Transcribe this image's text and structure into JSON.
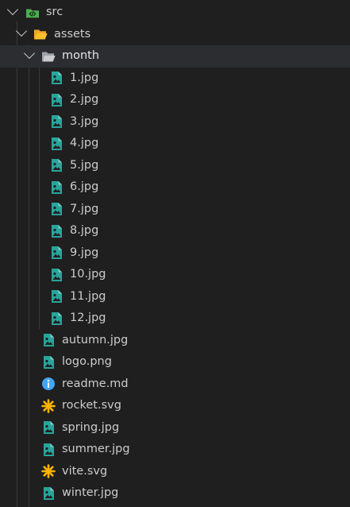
{
  "explorer": {
    "src_folder": {
      "label": "src",
      "icon": "folder-code-icon",
      "expanded": true
    },
    "assets_folder": {
      "label": "assets",
      "icon": "folder-open-icon",
      "expanded": true
    },
    "month_folder": {
      "label": "month",
      "icon": "folder-open-icon",
      "expanded": true,
      "selected": true
    },
    "month_files": [
      {
        "label": "1.jpg",
        "icon": "image-file-icon"
      },
      {
        "label": "2.jpg",
        "icon": "image-file-icon"
      },
      {
        "label": "3.jpg",
        "icon": "image-file-icon"
      },
      {
        "label": "4.jpg",
        "icon": "image-file-icon"
      },
      {
        "label": "5.jpg",
        "icon": "image-file-icon"
      },
      {
        "label": "6.jpg",
        "icon": "image-file-icon"
      },
      {
        "label": "7.jpg",
        "icon": "image-file-icon"
      },
      {
        "label": "8.jpg",
        "icon": "image-file-icon"
      },
      {
        "label": "9.jpg",
        "icon": "image-file-icon"
      },
      {
        "label": "10.jpg",
        "icon": "image-file-icon"
      },
      {
        "label": "11.jpg",
        "icon": "image-file-icon"
      },
      {
        "label": "12.jpg",
        "icon": "image-file-icon"
      }
    ],
    "asset_files": [
      {
        "label": "autumn.jpg",
        "icon": "image-file-icon"
      },
      {
        "label": "logo.png",
        "icon": "image-file-icon"
      },
      {
        "label": "readme.md",
        "icon": "info-icon"
      },
      {
        "label": "rocket.svg",
        "icon": "svg-asterisk-icon"
      },
      {
        "label": "spring.jpg",
        "icon": "image-file-icon"
      },
      {
        "label": "summer.jpg",
        "icon": "image-file-icon"
      },
      {
        "label": "vite.svg",
        "icon": "svg-asterisk-icon"
      },
      {
        "label": "winter.jpg",
        "icon": "image-file-icon"
      }
    ]
  },
  "colors": {
    "background": "#1f1f1f",
    "selected_row": "#2b2d31",
    "text": "#cccccc",
    "image_icon": "#26a69a",
    "info_icon": "#42a5f5",
    "svg_icon": "#ffb300",
    "folder_icon": "#c9cbd1",
    "assets_folder_icon": "#fbc02d",
    "src_folder_icon": "#4caf50"
  }
}
